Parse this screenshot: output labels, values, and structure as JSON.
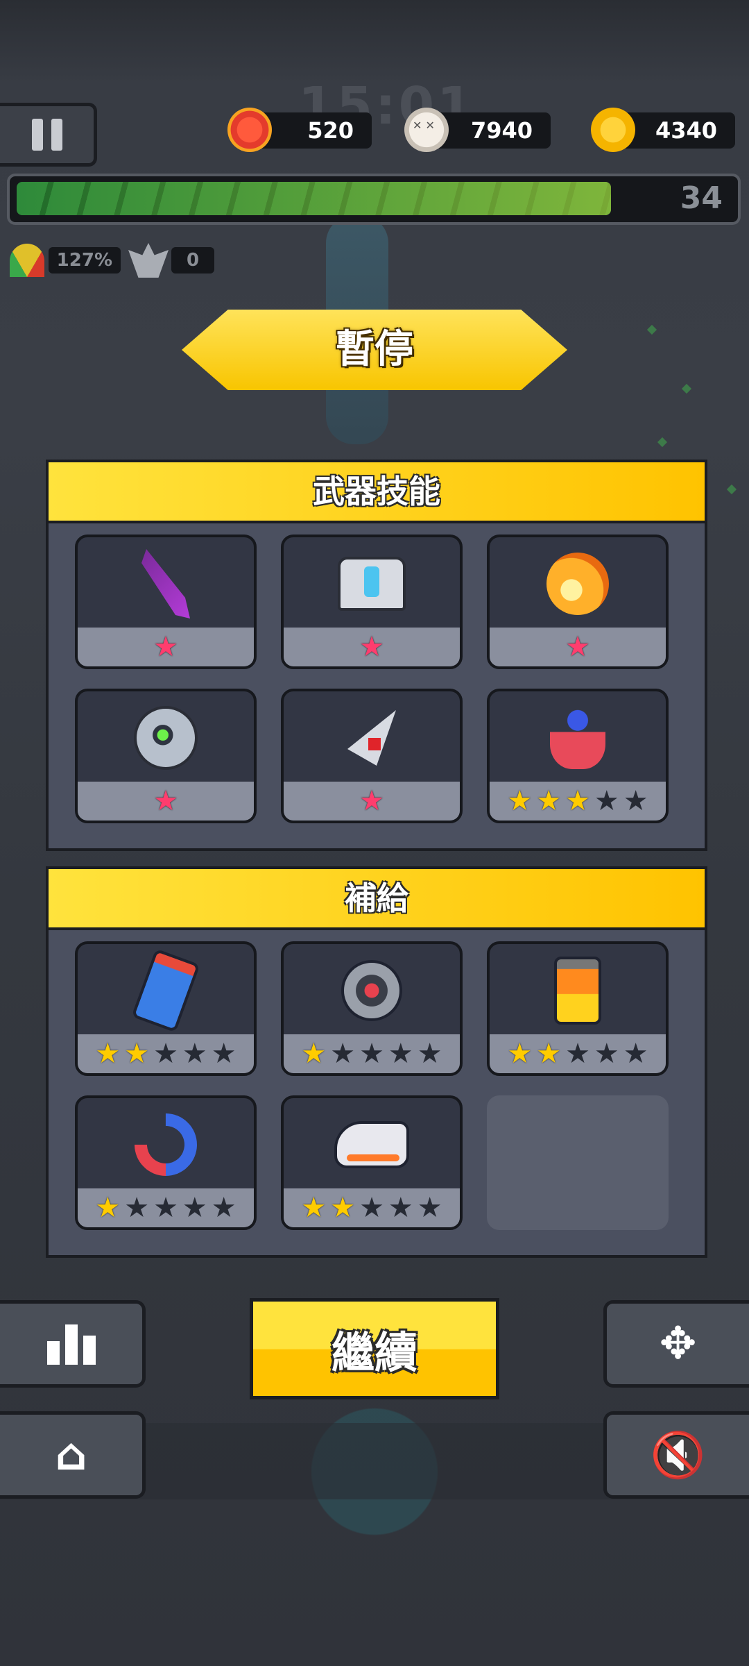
{
  "hud": {
    "timer": "15:01",
    "health": "520",
    "kills_total": "7940",
    "coins": "4340",
    "level": "34",
    "xp_progress": 0.84,
    "speed_percent": "127%",
    "kill_streak": "0"
  },
  "title": "暫停",
  "weapons_panel": {
    "title": "武器技能",
    "items": [
      {
        "icon": "crystal-sword-icon",
        "star_level": 1,
        "max_stars": 1,
        "star_color": "pink"
      },
      {
        "icon": "robot-helmet-icon",
        "star_level": 1,
        "max_stars": 1,
        "star_color": "pink"
      },
      {
        "icon": "fire-paw-icon",
        "star_level": 1,
        "max_stars": 1,
        "star_color": "pink"
      },
      {
        "icon": "eye-orb-icon",
        "star_level": 1,
        "max_stars": 1,
        "star_color": "pink"
      },
      {
        "icon": "ruby-dagger-icon",
        "star_level": 1,
        "max_stars": 1,
        "star_color": "pink"
      },
      {
        "icon": "tesla-coil-icon",
        "star_level": 3,
        "max_stars": 5,
        "star_color": "gold"
      }
    ]
  },
  "supply_panel": {
    "title": "補給",
    "items": [
      {
        "icon": "potion-bottle-icon",
        "star_level": 2,
        "max_stars": 5
      },
      {
        "icon": "gear-core-icon",
        "star_level": 1,
        "max_stars": 5
      },
      {
        "icon": "battery-icon",
        "star_level": 2,
        "max_stars": 5
      },
      {
        "icon": "magnet-icon",
        "star_level": 1,
        "max_stars": 5
      },
      {
        "icon": "sneaker-icon",
        "star_level": 2,
        "max_stars": 5
      },
      {
        "icon": "empty-slot",
        "star_level": 0,
        "max_stars": 0
      }
    ]
  },
  "buttons": {
    "continue": "繼續",
    "stats_icon": "bar-chart-icon",
    "home_icon": "home-icon",
    "control_icon": "dpad-icon",
    "mute_icon": "mute-icon"
  },
  "colors": {
    "accent_yellow": "#ffc300",
    "star_pink": "#ff3d6e",
    "star_gold": "#ffcc00",
    "panel_bg": "#4b5060"
  }
}
